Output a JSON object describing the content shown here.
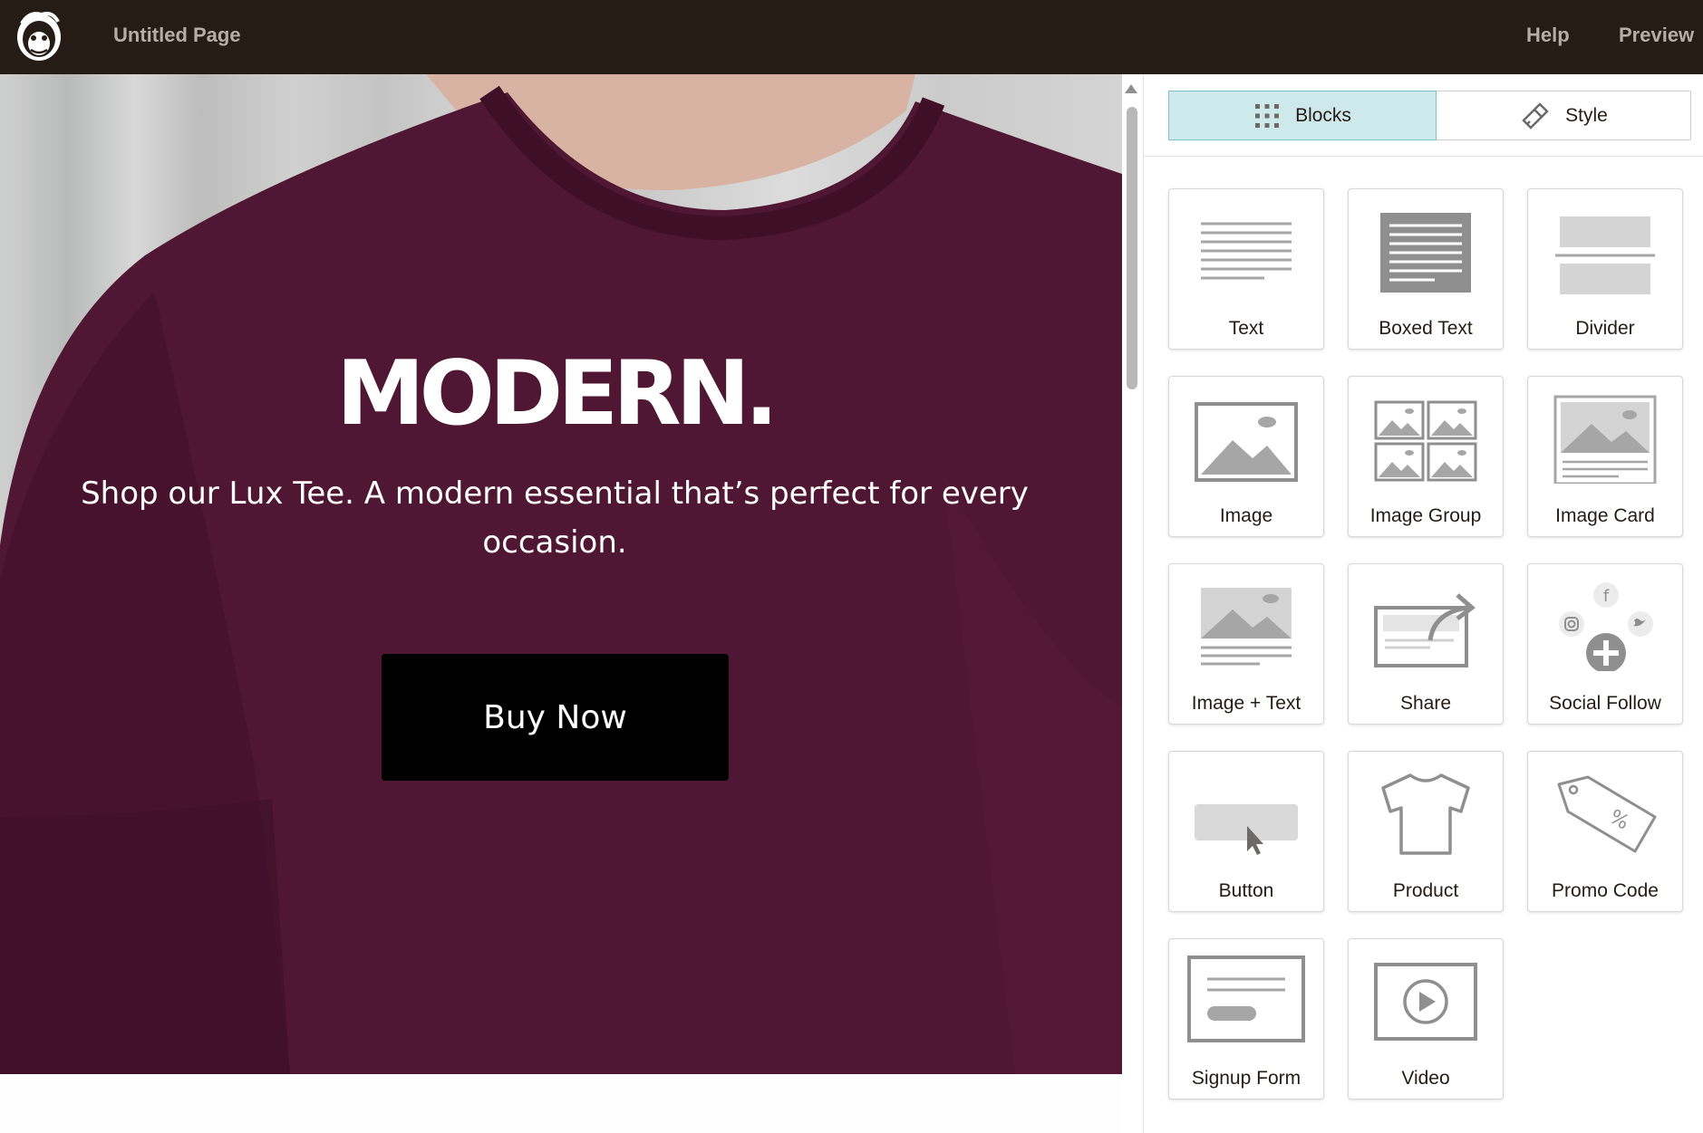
{
  "topbar": {
    "page_title": "Untitled Page",
    "help_label": "Help",
    "preview_label": "Preview"
  },
  "hero": {
    "title": "MODERN.",
    "subtitle": "Shop our Lux Tee. A modern essential that’s perfect for every occasion.",
    "button_label": "Buy Now"
  },
  "panel": {
    "tabs": [
      {
        "label": "Blocks",
        "icon": "grid-dots-icon",
        "selected": true
      },
      {
        "label": "Style",
        "icon": "paint-brush-icon",
        "selected": false
      }
    ],
    "blocks": [
      {
        "label": "Text",
        "icon": "text-block-icon"
      },
      {
        "label": "Boxed Text",
        "icon": "boxed-text-icon"
      },
      {
        "label": "Divider",
        "icon": "divider-icon"
      },
      {
        "label": "Image",
        "icon": "image-icon"
      },
      {
        "label": "Image Group",
        "icon": "image-group-icon"
      },
      {
        "label": "Image Card",
        "icon": "image-card-icon"
      },
      {
        "label": "Image + Text",
        "icon": "image-text-icon"
      },
      {
        "label": "Share",
        "icon": "share-icon"
      },
      {
        "label": "Social Follow",
        "icon": "social-follow-icon"
      },
      {
        "label": "Button",
        "icon": "button-block-icon"
      },
      {
        "label": "Product",
        "icon": "tshirt-icon"
      },
      {
        "label": "Promo Code",
        "icon": "promo-tag-icon"
      },
      {
        "label": "Signup Form",
        "icon": "signup-form-icon"
      },
      {
        "label": "Video",
        "icon": "video-play-icon"
      }
    ]
  },
  "colors": {
    "topbar_bg": "#241c15",
    "shirt": "#4f1733",
    "selected_tab_bg": "#cde9ec",
    "button_bg": "#000000"
  }
}
